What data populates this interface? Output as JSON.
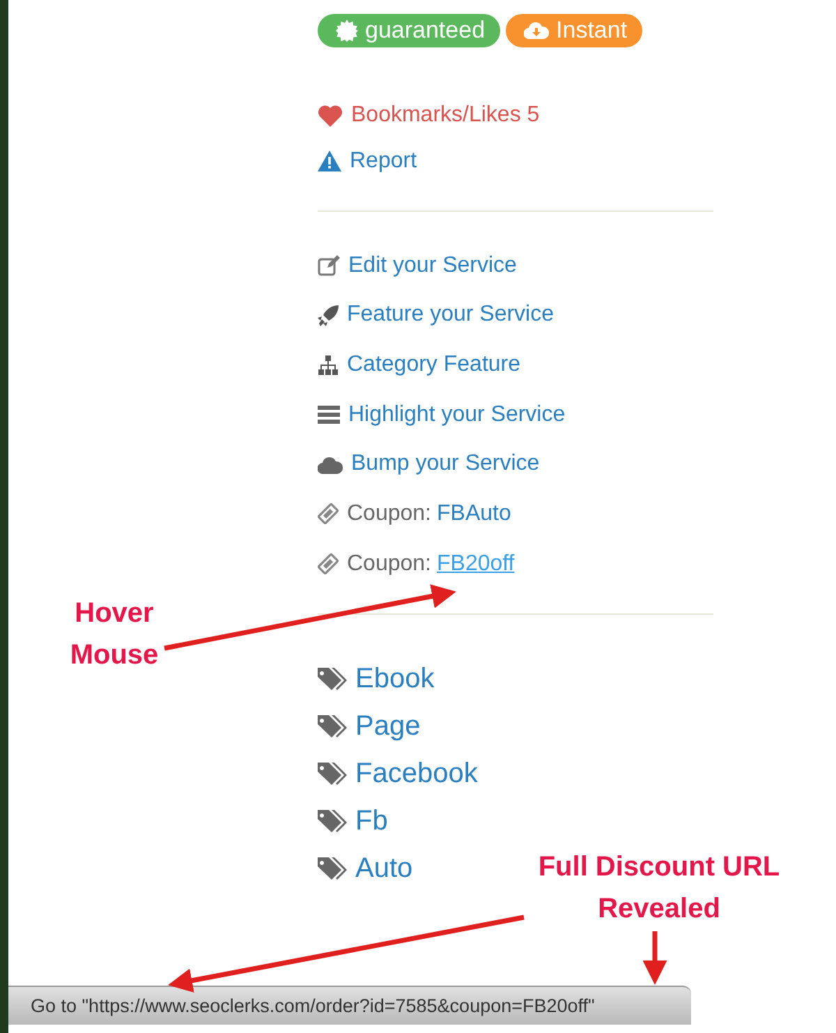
{
  "badges": [
    {
      "kind": "guaranteed",
      "label": "guaranteed",
      "color": "#5cb85c"
    },
    {
      "kind": "instant",
      "label": "Instant",
      "color": "#f7922e"
    }
  ],
  "stats": [
    {
      "kind": "likes",
      "label": "Bookmarks/Likes 5"
    },
    {
      "kind": "report",
      "label": "Report"
    }
  ],
  "actions": [
    {
      "kind": "edit",
      "label": "Edit your Service"
    },
    {
      "kind": "feature",
      "label": "Feature your Service"
    },
    {
      "kind": "category",
      "label": "Category Feature"
    },
    {
      "kind": "highlight",
      "label": "Highlight your Service"
    },
    {
      "kind": "bump",
      "label": "Bump your Service"
    },
    {
      "kind": "coupon",
      "label": "Coupon:",
      "code": "FBAuto",
      "hovered": false
    },
    {
      "kind": "coupon",
      "label": "Coupon:",
      "code": "FB20off",
      "hovered": true
    }
  ],
  "tags": [
    "Ebook",
    "Page",
    "Facebook",
    "Fb",
    "Auto"
  ],
  "status_bar": {
    "text": "Go to \"https://www.seoclerks.com/order?id=7585&coupon=FB20off\""
  },
  "annotations": [
    {
      "kind": "hover",
      "text": "Hover Mouse"
    },
    {
      "kind": "url",
      "text": "Full Discount URL Revealed"
    }
  ]
}
